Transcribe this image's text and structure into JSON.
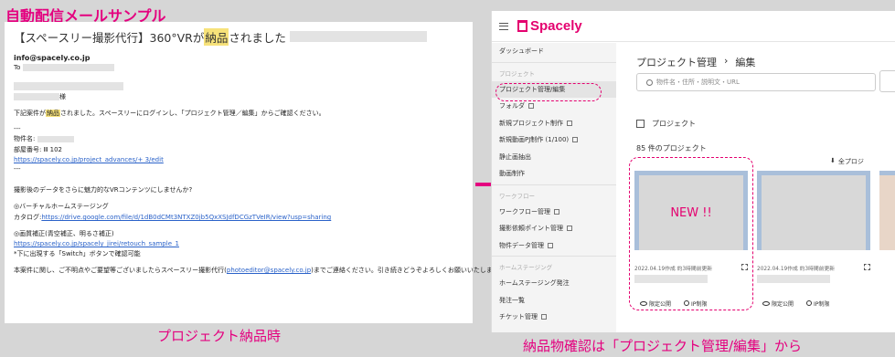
{
  "captions": {
    "top": "自動配信メールサンプル",
    "left": "プロジェクト納品時",
    "right": "納品物確認は「プロジェクト管理/編集」から"
  },
  "email": {
    "subject_prefix": "【スペースリー撮影代行】360°VRが",
    "subject_highlight": "納品",
    "subject_suffix": "されました",
    "from": "info@spacely.co.jp",
    "to_label": "To",
    "salutation": "様",
    "body_intro_pre": "下記案件が",
    "body_intro_hl": "納品",
    "body_intro_post": "されました。スペースリーにログインし、「プロジェクト管理／編集」からご確認ください。",
    "sep1": "---",
    "property_label": "物件名:",
    "room_label": "部屋番号: Ⅲ 102",
    "project_url": "https://spacely.co.jp/project_advances/+ 3/edit",
    "sep2": "---",
    "vr_question": "撮影後のデータをさらに魅力的なVRコンテンツにしませんか?",
    "staging_title": "◎バーチャルホームステージング",
    "catalog_label": "カタログ:",
    "catalog_url": "https://drive.google.com/file/d/1dB0dCMt3NTXZ0jb5QxXSJdfDCGzTVeIR/view?usp=sharing",
    "retouch_title": "◎画質補正(青空補正、明るさ補正)",
    "retouch_url": "https://spacely.co.jp/spacely_jirei/retouch_sample_1",
    "retouch_note": "*下に出現する「Switch」ボタンで確認可能",
    "footer_pre": "本案件に関し、ご不明点やご要望等ございましたらスペースリー撮影代行(",
    "footer_email": "photoeditor@spacely.co.jp",
    "footer_post": ")までご連絡ください。引き続きどうぞよろしくお願いいたします。"
  },
  "app": {
    "brand": "Spacely",
    "sidebar": {
      "items": [
        {
          "label": "ダッシュボード",
          "type": "item"
        },
        {
          "label": "プロジェクト",
          "type": "section"
        },
        {
          "label": "プロジェクト管理/編集",
          "type": "item",
          "active": true
        },
        {
          "label": "フォルダ",
          "type": "item",
          "ext": true
        },
        {
          "label": "新規プロジェクト制作",
          "type": "item",
          "ext": true
        },
        {
          "label": "新規動画PJ制作 (1/100)",
          "type": "item",
          "ext": true
        },
        {
          "label": "静止画抽出",
          "type": "item"
        },
        {
          "label": "動画制作",
          "type": "item"
        },
        {
          "label": "ワークフロー",
          "type": "section"
        },
        {
          "label": "ワークフロー管理",
          "type": "item",
          "ext": true
        },
        {
          "label": "撮影依頼ポイント管理",
          "type": "item",
          "ext": true
        },
        {
          "label": "物件データ管理",
          "type": "item",
          "ext": true
        },
        {
          "label": "ホームステージング",
          "type": "section"
        },
        {
          "label": "ホームステージング発注",
          "type": "item"
        },
        {
          "label": "発注一覧",
          "type": "item"
        },
        {
          "label": "チケット管理",
          "type": "item",
          "ext": true
        }
      ]
    },
    "main": {
      "breadcrumb_1": "プロジェクト管理",
      "breadcrumb_sep": "›",
      "breadcrumb_2": "編集",
      "search_placeholder": "物件名・住所・説明文・URL",
      "filter_label": "プロジェクト",
      "count_label": "85 件のプロジェクト",
      "download_label": "全プロジ",
      "cards": [
        {
          "thumb_text": "NEW !!",
          "meta": "2022.04.19作成 約3時間前更新",
          "public": "限定公開",
          "ip": "IP制限"
        },
        {
          "thumb_text": "",
          "meta": "2022.04.19作成 約3時間前更新",
          "public": "限定公開",
          "ip": "IP制限"
        }
      ]
    }
  },
  "colors": {
    "accent": "#e4007f",
    "link": "#2a62c9",
    "highlight": "#f7e27a"
  }
}
